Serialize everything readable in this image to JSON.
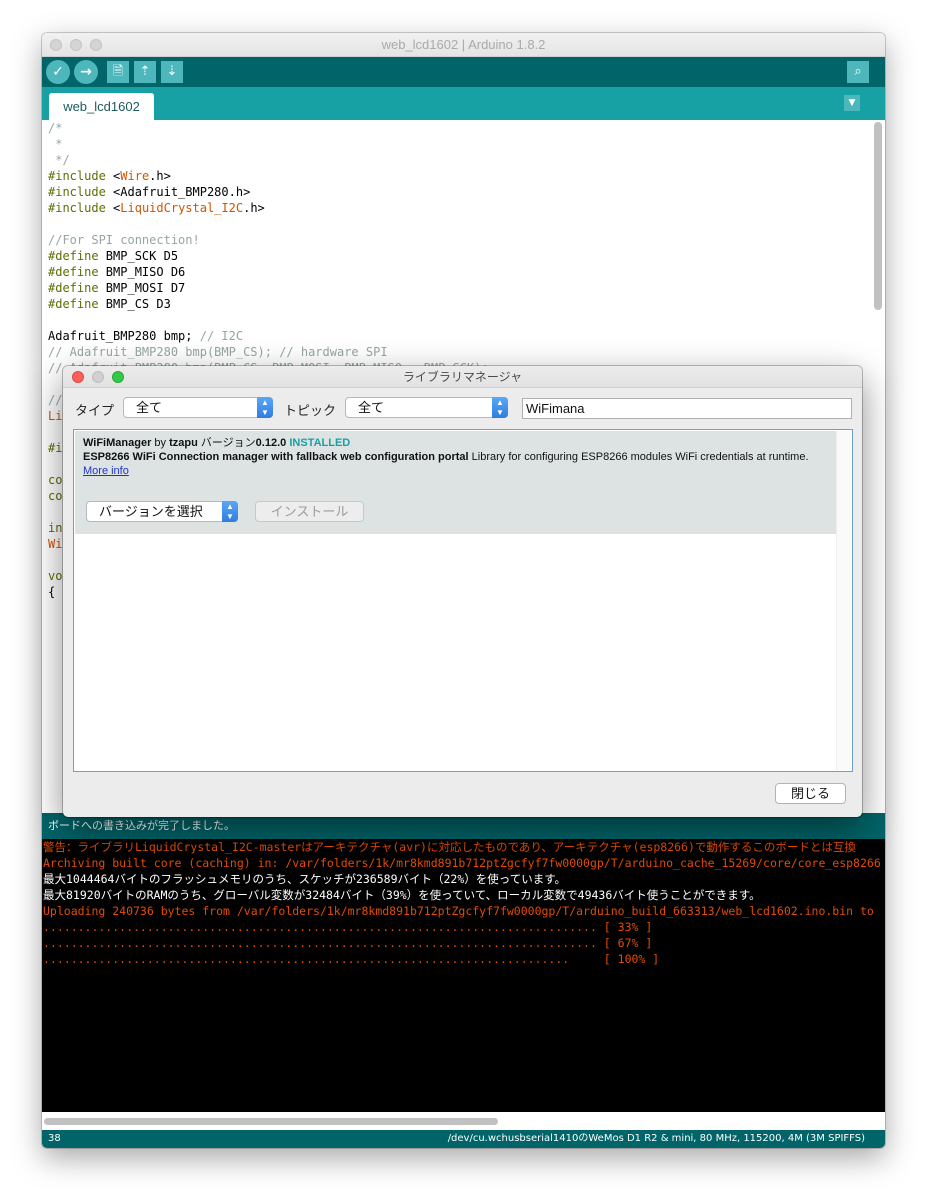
{
  "window": {
    "title": "web_lcd1602 | Arduino 1.8.2",
    "toolbar": {
      "verify_icon": "✓",
      "upload_icon": "→",
      "new_icon": "🗎",
      "open_icon": "⇡",
      "save_icon": "⇣",
      "serial_monitor_icon": "⌕"
    },
    "tab": {
      "label": "web_lcd1602"
    },
    "tab_menu_icon": "▼"
  },
  "code_lines": [
    [
      {
        "t": "/*",
        "c": "cmt"
      }
    ],
    [
      {
        "t": " *",
        "c": "cmt"
      }
    ],
    [
      {
        "t": " */",
        "c": "cmt"
      }
    ],
    [
      {
        "t": "#include ",
        "c": "kw"
      },
      {
        "t": "<",
        "c": ""
      },
      {
        "t": "Wire",
        "c": "lib"
      },
      {
        "t": ".h>",
        "c": ""
      }
    ],
    [
      {
        "t": "#include ",
        "c": "kw"
      },
      {
        "t": "<Adafruit_BMP280.h>",
        "c": ""
      }
    ],
    [
      {
        "t": "#include ",
        "c": "kw"
      },
      {
        "t": "<",
        "c": ""
      },
      {
        "t": "LiquidCrystal_I2C",
        "c": "lib"
      },
      {
        "t": ".h>",
        "c": ""
      }
    ],
    [
      {
        "t": "",
        "c": ""
      }
    ],
    [
      {
        "t": "//For SPI connection!",
        "c": "cmt"
      }
    ],
    [
      {
        "t": "#define ",
        "c": "kw"
      },
      {
        "t": "BMP_SCK D5",
        "c": ""
      }
    ],
    [
      {
        "t": "#define ",
        "c": "kw"
      },
      {
        "t": "BMP_MISO D6",
        "c": ""
      }
    ],
    [
      {
        "t": "#define ",
        "c": "kw"
      },
      {
        "t": "BMP_MOSI D7",
        "c": ""
      }
    ],
    [
      {
        "t": "#define ",
        "c": "kw"
      },
      {
        "t": "BMP_CS D3",
        "c": ""
      }
    ],
    [
      {
        "t": "",
        "c": ""
      }
    ],
    [
      {
        "t": "Adafruit_BMP280 bmp; ",
        "c": ""
      },
      {
        "t": "// I2C",
        "c": "cmt"
      }
    ],
    [
      {
        "t": "// Adafruit_BMP280 bmp(BMP_CS); // hardware SPI",
        "c": "cmt"
      }
    ],
    [
      {
        "t": "// Adafruit_BMP280 bmp(BMP_CS, BMP_MOSI, BMP_MISO,  BMP_SCK);",
        "c": "cmt"
      }
    ],
    [
      {
        "t": "",
        "c": ""
      }
    ],
    [
      {
        "t": "//",
        "c": "cmt"
      }
    ],
    [
      {
        "t": "Li",
        "c": "lib"
      }
    ],
    [
      {
        "t": "",
        "c": ""
      }
    ],
    [
      {
        "t": "#i",
        "c": "kw"
      }
    ],
    [
      {
        "t": "",
        "c": ""
      }
    ],
    [
      {
        "t": "co",
        "c": "kw"
      }
    ],
    [
      {
        "t": "co",
        "c": "kw"
      }
    ],
    [
      {
        "t": "",
        "c": ""
      }
    ],
    [
      {
        "t": "in",
        "c": "kw"
      }
    ],
    [
      {
        "t": "Wi",
        "c": "lib"
      }
    ],
    [
      {
        "t": "",
        "c": ""
      }
    ],
    [
      {
        "t": "vo",
        "c": "kw"
      }
    ],
    [
      {
        "t": "{",
        "c": ""
      }
    ]
  ],
  "status": {
    "message": "ボードへの書き込みが完了しました。"
  },
  "console_lines": [
    {
      "text": "警告：ライブラリLiquidCrystal_I2C-masterはアーキテクチャ(avr)に対応したものであり、アーキテクチャ(esp8266)で動作するこのボードとは互換",
      "color": "red"
    },
    {
      "text": "Archiving built core (caching) in: /var/folders/1k/mr8kmd891b712ptZgcfyf7fw0000gp/T/arduino_cache_15269/core/core_esp8266",
      "color": "red"
    },
    {
      "text": "最大1044464バイトのフラッシュメモリのうち、スケッチが236589バイト（22%）を使っています。",
      "color": "white"
    },
    {
      "text": "最大81920バイトのRAMのうち、グローバル変数が32484バイト（39%）を使っていて、ローカル変数で49436バイト使うことができます。",
      "color": "white"
    },
    {
      "text": "Uploading 240736 bytes from /var/folders/1k/mr8kmd891b712ptZgcfyf7fw0000gp/T/arduino_build_663313/web_lcd1602.ino.bin to",
      "color": "red"
    },
    {
      "text": "................................................................................ [ 33% ]",
      "color": "red"
    },
    {
      "text": "................................................................................ [ 67% ]",
      "color": "red"
    },
    {
      "text": "............................................................................     [ 100% ]",
      "color": "red"
    }
  ],
  "footer": {
    "line_number": "38",
    "board_info": "/dev/cu.wchusbserial1410のWeMos D1 R2 & mini, 80 MHz, 115200, 4M (3M SPIFFS)"
  },
  "dialog": {
    "title": "ライブラリマネージャ",
    "type_label": "タイプ",
    "type_value": "全て",
    "topic_label": "トピック",
    "topic_value": "全て",
    "search_value": "WiFimana",
    "library": {
      "name": "WiFiManager",
      "by": " by ",
      "author": "tzapu",
      "version_prefix": " バージョン",
      "version": "0.12.0",
      "installed": "INSTALLED",
      "sentence_bold": "ESP8266 WiFi Connection manager with fallback web configuration portal",
      "paragraph": " Library for configuring ESP8266 modules WiFi credentials at runtime.",
      "more_info": "More info",
      "version_select": "バージョンを選択",
      "install_button": "インストール"
    },
    "close_button": "閉じる"
  },
  "colors": {
    "toolbar": "#006468",
    "tabbar": "#17a1a5",
    "console_red": "#e34c00",
    "installed": "#1aa0a4"
  }
}
